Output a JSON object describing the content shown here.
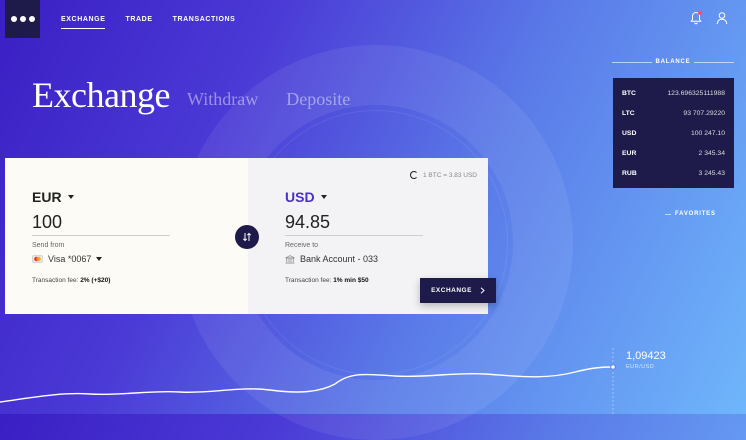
{
  "nav": {
    "items": [
      {
        "label": "EXCHANGE",
        "active": true
      },
      {
        "label": "TRADE",
        "active": false
      },
      {
        "label": "TRANSACTIONS",
        "active": false
      }
    ]
  },
  "header_icons": [
    "bell-icon",
    "user-icon"
  ],
  "page": {
    "title": "Exchange",
    "tabs": [
      "Withdraw",
      "Deposite"
    ]
  },
  "from": {
    "currency": "EUR",
    "amount": "100",
    "source_label": "Send from",
    "source_value": "Visa *0067",
    "fee_label": "Transaction fee:",
    "fee_value": "2% (+$20)"
  },
  "to": {
    "currency": "USD",
    "amount": "94.85",
    "rate_text": "1 BTC = 3.83 USD",
    "target_label": "Receive to",
    "target_value": "Bank Account - 033",
    "fee_label": "Transaction fee:",
    "fee_value": "1% min $50"
  },
  "exchange_button": {
    "label": "EXCHANGE"
  },
  "balance": {
    "label": "BALANCE",
    "rows": [
      {
        "code": "BTC",
        "value": "123.696325111988"
      },
      {
        "code": "LTC",
        "value": "93 707.29220"
      },
      {
        "code": "USD",
        "value": "100 247.10"
      },
      {
        "code": "EUR",
        "value": "2 345.34"
      },
      {
        "code": "RUB",
        "value": "3 245.43"
      }
    ]
  },
  "favorites": {
    "label": "FAVORITES"
  },
  "chart": {
    "current_value": "1,09423",
    "pair": "EUR/USD"
  },
  "colors": {
    "navy": "#1e1a4a",
    "gradient_start": "#3a1fc4",
    "gradient_end": "#6fb6fb",
    "notification": "#ff4a6a",
    "accent_purple": "#4a30c8"
  }
}
